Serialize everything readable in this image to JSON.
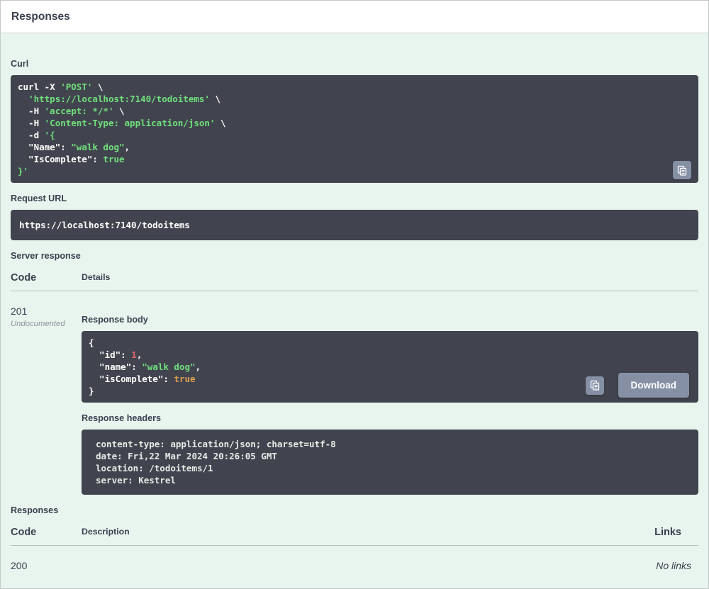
{
  "colors": {
    "panel-bg": "#e8f4ee",
    "code-bg": "#41444e",
    "text": "#3b4151",
    "muted": "#8e949b",
    "string-green": "#70e07c",
    "number-red": "#e5646e",
    "boolean-orange": "#dfa14e",
    "headers-text": "#e6ede7",
    "button-gray": "#8690a5"
  },
  "panel": {
    "title": "Responses"
  },
  "curl": {
    "label": "Curl",
    "copy_icon": "clipboard-icon",
    "tokens": [
      {
        "t": "curl -X ",
        "c": "plain"
      },
      {
        "t": "'POST'",
        "c": "str"
      },
      {
        "t": " \\\n  ",
        "c": "plain"
      },
      {
        "t": "'https://localhost:7140/todoitems'",
        "c": "str"
      },
      {
        "t": " \\\n  -H ",
        "c": "plain"
      },
      {
        "t": "'accept: */*'",
        "c": "str"
      },
      {
        "t": " \\\n  -H ",
        "c": "plain"
      },
      {
        "t": "'Content-Type: application/json'",
        "c": "str"
      },
      {
        "t": " \\\n  -d ",
        "c": "plain"
      },
      {
        "t": "'{",
        "c": "str"
      },
      {
        "t": "\n  \"Name\": ",
        "c": "plain"
      },
      {
        "t": "\"walk dog\"",
        "c": "str"
      },
      {
        "t": ",\n  \"IsComplete\": ",
        "c": "plain"
      },
      {
        "t": "true",
        "c": "str"
      },
      {
        "t": "\n",
        "c": "plain"
      },
      {
        "t": "}'",
        "c": "str"
      }
    ]
  },
  "request_url": {
    "label": "Request URL",
    "value": "https://localhost:7140/todoitems"
  },
  "server_response": {
    "label": "Server response",
    "code_header": "Code",
    "details_header": "Details",
    "code": "201",
    "undocumented": "Undocumented",
    "response_body_label": "Response body",
    "copy_icon": "clipboard-icon",
    "download_label": "Download",
    "body_tokens": [
      {
        "t": "{\n  \"id\": ",
        "c": "plain"
      },
      {
        "t": "1",
        "c": "num"
      },
      {
        "t": ",\n  \"name\": ",
        "c": "plain"
      },
      {
        "t": "\"walk dog\"",
        "c": "str"
      },
      {
        "t": ",\n  \"isComplete\": ",
        "c": "plain"
      },
      {
        "t": "true",
        "c": "bool"
      },
      {
        "t": "\n}",
        "c": "plain"
      }
    ],
    "response_headers_label": "Response headers",
    "headers": [
      "content-type: application/json; charset=utf-8",
      "date: Fri,22 Mar 2024 20:26:05 GMT",
      "location: /todoitems/1",
      "server: Kestrel"
    ]
  },
  "responses": {
    "label": "Responses",
    "code_header": "Code",
    "description_header": "Description",
    "links_header": "Links",
    "rows": [
      {
        "code": "200",
        "description": "",
        "links": "No links"
      }
    ]
  }
}
